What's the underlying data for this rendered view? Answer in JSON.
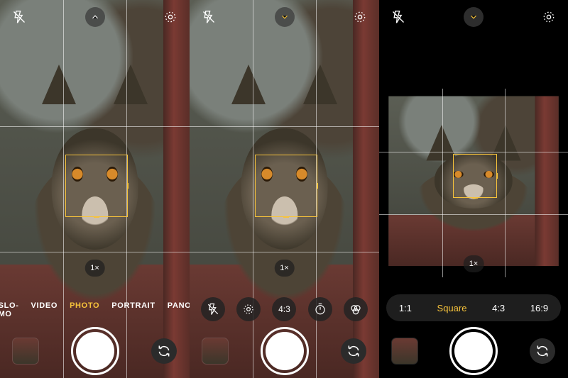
{
  "zoom_label": "1×",
  "modes": {
    "items": [
      "SLO-MO",
      "VIDEO",
      "PHOTO",
      "PORTRAIT",
      "PANO"
    ],
    "selected": "PHOTO"
  },
  "quick_settings": {
    "aspect_label": "4:3"
  },
  "aspect_picker": {
    "items": [
      "1:1",
      "Square",
      "4:3",
      "16:9"
    ],
    "selected": "Square"
  },
  "icons": {
    "flash_off": "flash-off",
    "live_photo": "live-photo",
    "chevron_up": "chevron-up",
    "chevron_down": "chevron-down",
    "timer": "timer",
    "filters": "filters",
    "flip": "camera-flip"
  },
  "colors": {
    "accent": "#f7c33b"
  }
}
